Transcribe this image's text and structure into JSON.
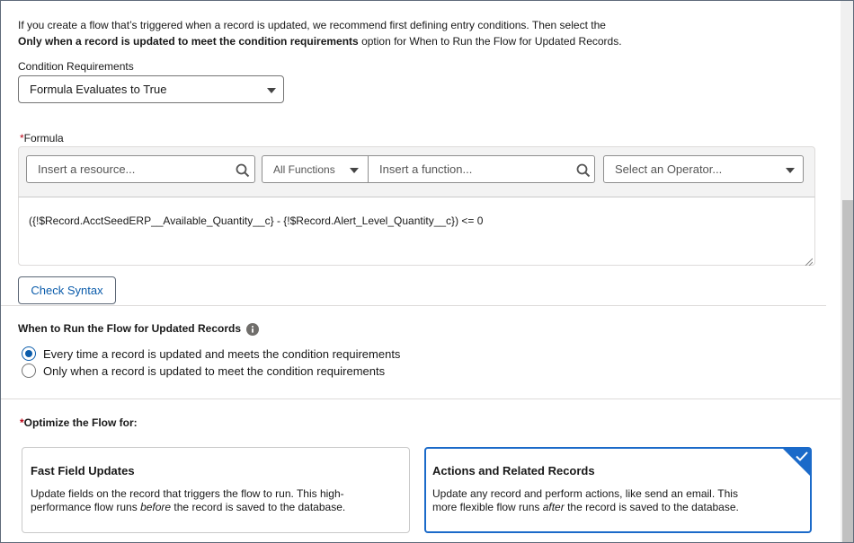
{
  "intro": {
    "line1": "If you create a flow that’s triggered when a record is updated, we recommend first defining entry conditions. Then select the",
    "line2_bold": "Only when a record is updated to meet the condition requirements",
    "line2_rest": " option for When to Run the Flow for Updated Records."
  },
  "condition": {
    "label": "Condition Requirements",
    "selected": "Formula Evaluates to True"
  },
  "formula": {
    "required_mark": "*",
    "label": "Formula",
    "resource_placeholder": "Insert a resource...",
    "functions_selected": "All Functions",
    "function_placeholder": "Insert a function...",
    "operator_placeholder": "Select an Operator...",
    "expression": "({!$Record.AcctSeedERP__Available_Quantity__c} - {!$Record.Alert_Level_Quantity__c}) <= 0",
    "check_syntax": "Check Syntax"
  },
  "when_to_run": {
    "title": "When to Run the Flow for Updated Records",
    "options": [
      {
        "label": "Every time a record is updated and meets the condition requirements",
        "checked": true
      },
      {
        "label": "Only when a record is updated to meet the condition requirements",
        "checked": false
      }
    ]
  },
  "optimize": {
    "required_mark": "*",
    "title": "Optimize the Flow for:",
    "cards": [
      {
        "title": "Fast Field Updates",
        "desc_a": "Update fields on the record that triggers the flow to run. This high-",
        "desc_b": "performance flow runs ",
        "desc_em": "before",
        "desc_c": " the record is saved to the database.",
        "selected": false
      },
      {
        "title": "Actions and Related Records",
        "desc_a": "Update any record and perform actions, like send an email. This",
        "desc_b": "more flexible flow runs ",
        "desc_em": "after",
        "desc_c": " the record is saved to the database.",
        "selected": true
      }
    ]
  },
  "colors": {
    "brand_blue": "#0b5cab",
    "selected_border": "#1b6ac9",
    "required_red": "#ba0517"
  }
}
